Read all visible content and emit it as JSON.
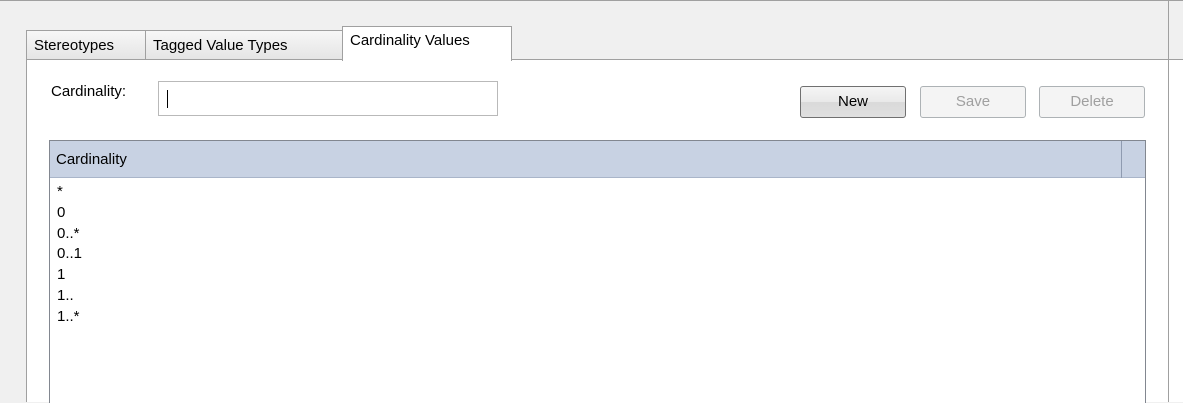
{
  "tabs": [
    {
      "label": "Stereotypes"
    },
    {
      "label": "Tagged Value Types"
    },
    {
      "label": "Cardinality Values"
    }
  ],
  "form": {
    "cardinality_label": "Cardinality:",
    "cardinality_value": ""
  },
  "buttons": {
    "new": "New",
    "save": "Save",
    "delete": "Delete"
  },
  "list": {
    "column_header": "Cardinality",
    "rows": [
      "*",
      "0",
      "0..*",
      "0..1",
      "1",
      "1..",
      "1..*"
    ]
  }
}
